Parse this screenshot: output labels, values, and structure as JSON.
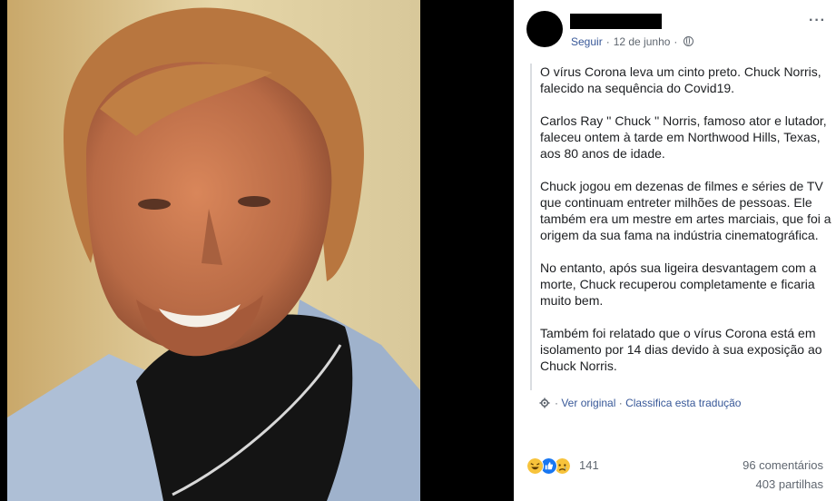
{
  "post": {
    "follow_label": "Seguir",
    "date": "12 de junho",
    "more_label": "···",
    "paragraphs": [
      "O vírus Corona leva um cinto preto. Chuck Norris, falecido na sequência do Covid19.",
      "Carlos Ray '' Chuck '' Norris, famoso ator e lutador, faleceu ontem à tarde em Northwood Hills, Texas, aos 80 anos de idade.",
      "Chuck jogou em dezenas de filmes e séries de TV que continuam entreter milhões de pessoas. Ele também era um mestre em artes marciais, que foi a origem da sua fama na indústria cinematográfica.",
      "No entanto, após sua ligeira desvantagem com a morte, Chuck recuperou completamente e ficaria muito bem.",
      "Também foi relatado que o vírus Corona está em isolamento por 14 dias devido à sua exposição ao Chuck Norris."
    ],
    "see_original": "Ver original",
    "rate_translation": "Classifica esta tradução",
    "link_separator": "·",
    "reaction_count": "141",
    "comments": "96 comentários",
    "shares": "403 partilhas"
  },
  "colors": {
    "link": "#385898",
    "secondary_text": "#606770",
    "body_text": "#1c1e21"
  },
  "icons": [
    "globe-icon",
    "more-options-icon",
    "gear-icon",
    "haha-reaction-icon",
    "like-reaction-icon",
    "sad-reaction-icon"
  ]
}
